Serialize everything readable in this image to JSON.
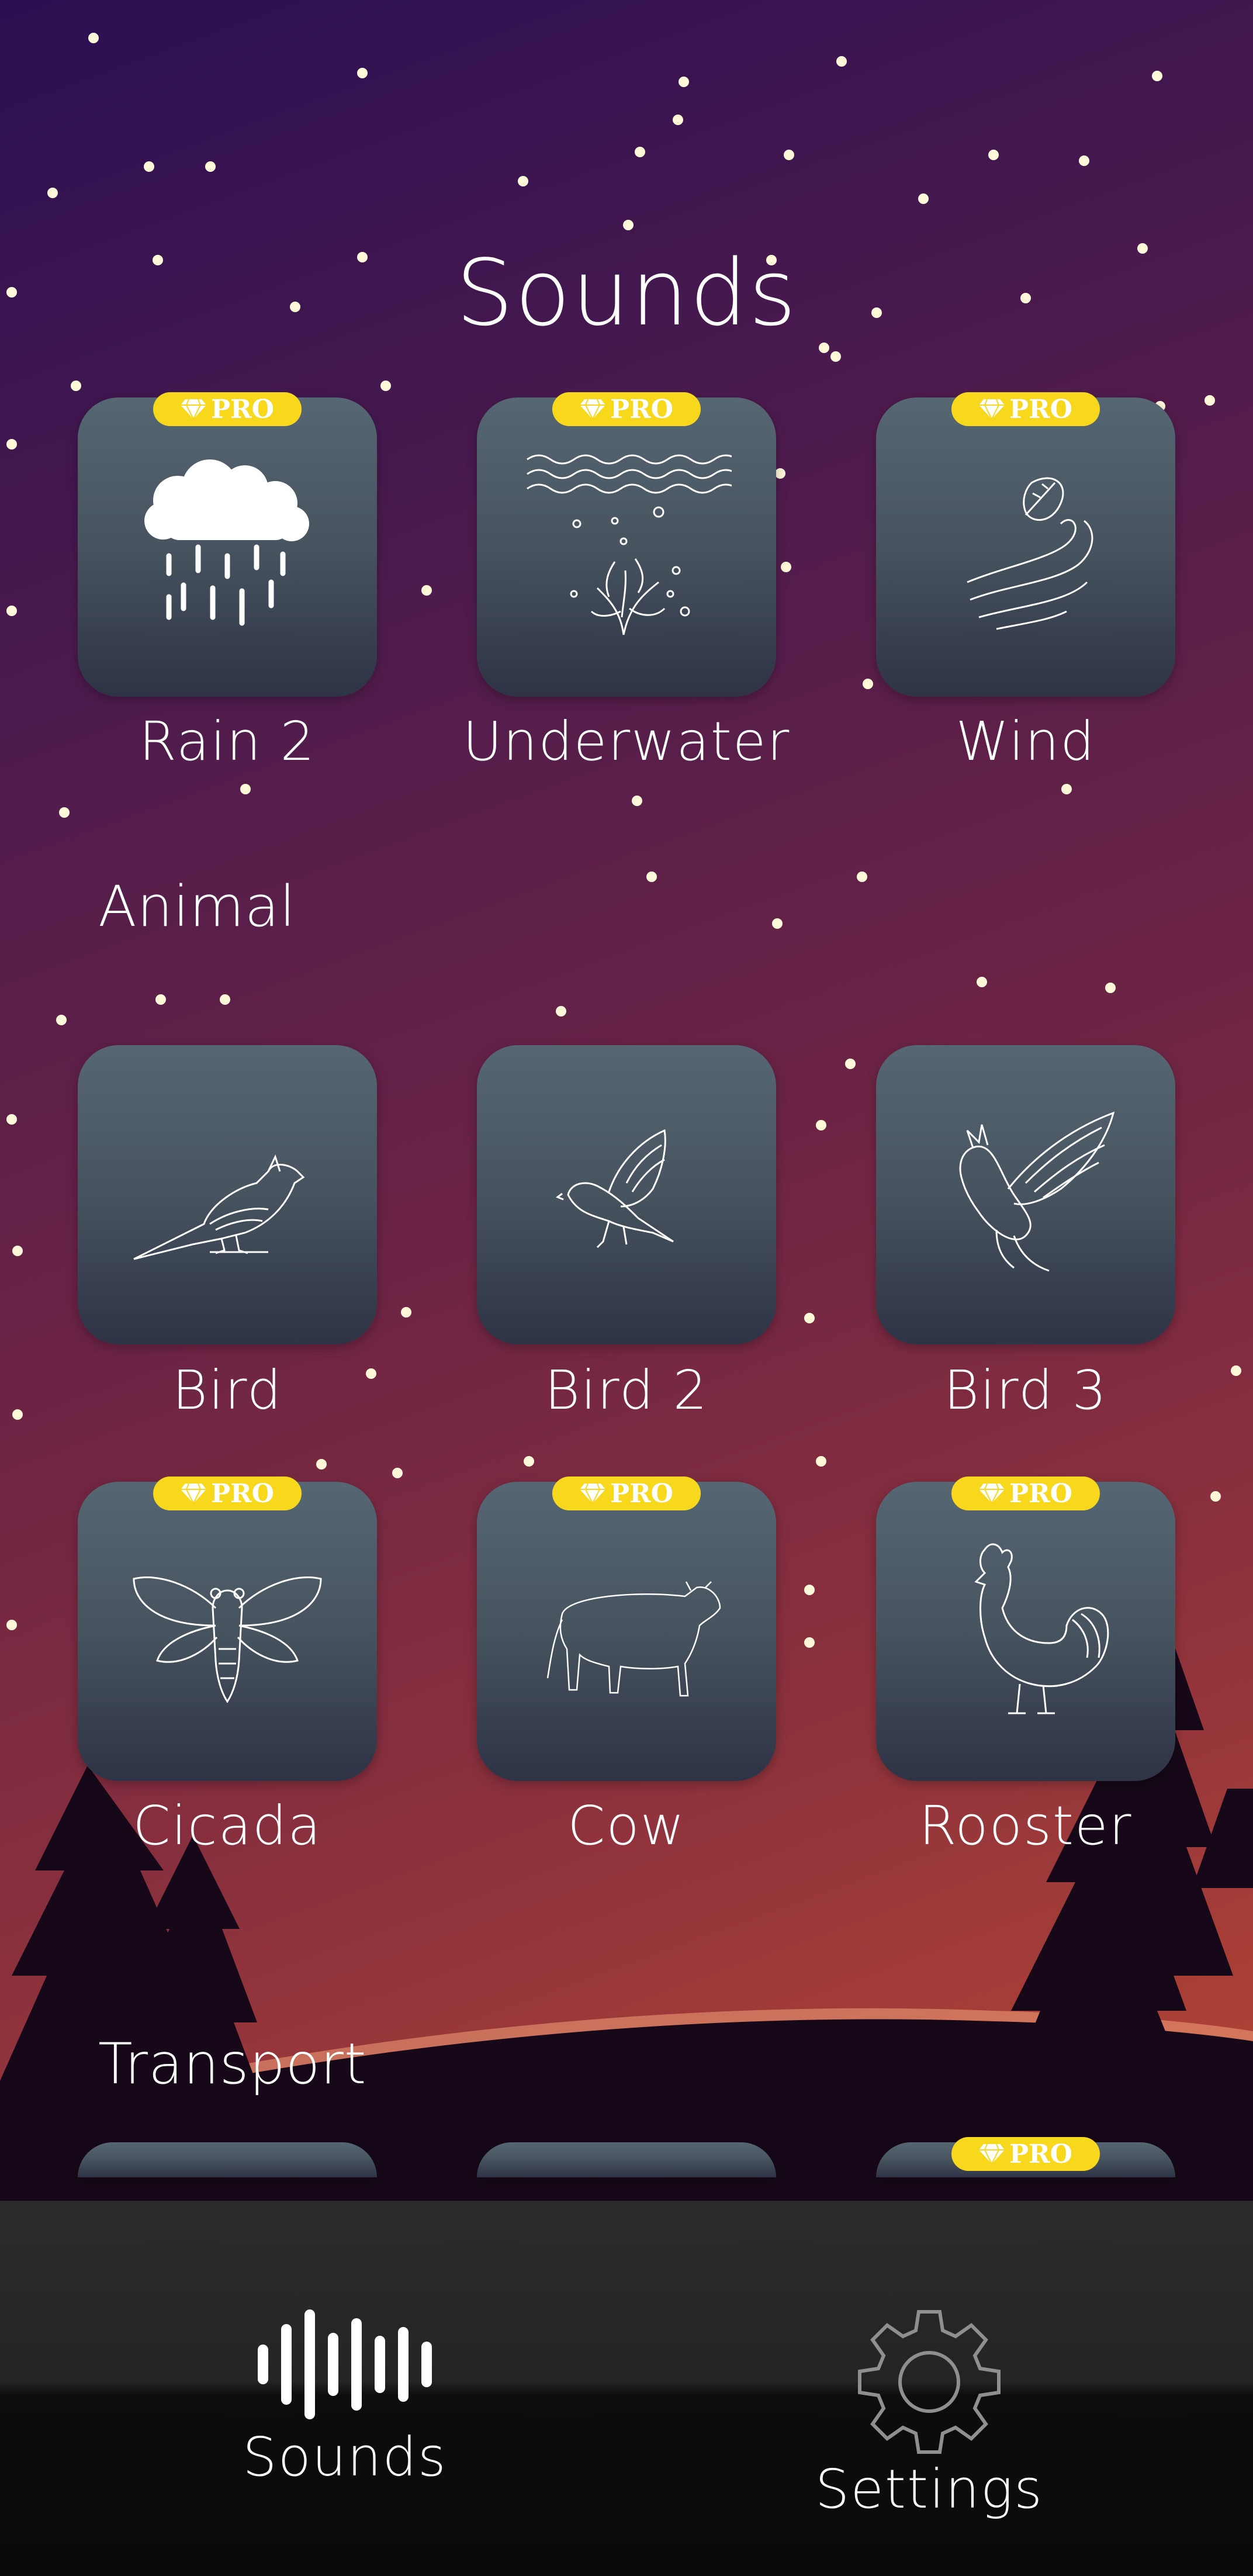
{
  "header": {
    "title": "Sounds"
  },
  "top_row": [
    {
      "label": "Rain 2",
      "icon": "rain-cloud-icon",
      "pro": true
    },
    {
      "label": "Underwater",
      "icon": "underwater-coral-icon",
      "pro": true
    },
    {
      "label": "Wind",
      "icon": "wind-leaf-icon",
      "pro": true
    }
  ],
  "sections": {
    "animal": {
      "title": "Animal",
      "items": [
        {
          "label": "Bird",
          "icon": "cardinal-bird-icon",
          "pro": false
        },
        {
          "label": "Bird 2",
          "icon": "flying-bird-icon",
          "pro": false
        },
        {
          "label": "Bird 3",
          "icon": "cockatoo-icon",
          "pro": false
        },
        {
          "label": "Cicada",
          "icon": "cicada-icon",
          "pro": true
        },
        {
          "label": "Cow",
          "icon": "cow-icon",
          "pro": true
        },
        {
          "label": "Rooster",
          "icon": "rooster-icon",
          "pro": true
        }
      ]
    },
    "transport": {
      "title": "Transport",
      "items": [
        {
          "pro": false
        },
        {
          "pro": false
        },
        {
          "pro": true
        }
      ]
    }
  },
  "badge": {
    "pro_label": "PRO",
    "color": "#f7d81c",
    "icon": "diamond-icon"
  },
  "tabbar": {
    "tabs": [
      {
        "label": "Sounds",
        "icon": "sound-wave-icon",
        "active": true
      },
      {
        "label": "Settings",
        "icon": "gear-icon",
        "active": false
      }
    ]
  },
  "colors": {
    "tile_top": "#566673",
    "tile_bottom": "#2e3345",
    "tabbar": "#1a1a1a"
  }
}
